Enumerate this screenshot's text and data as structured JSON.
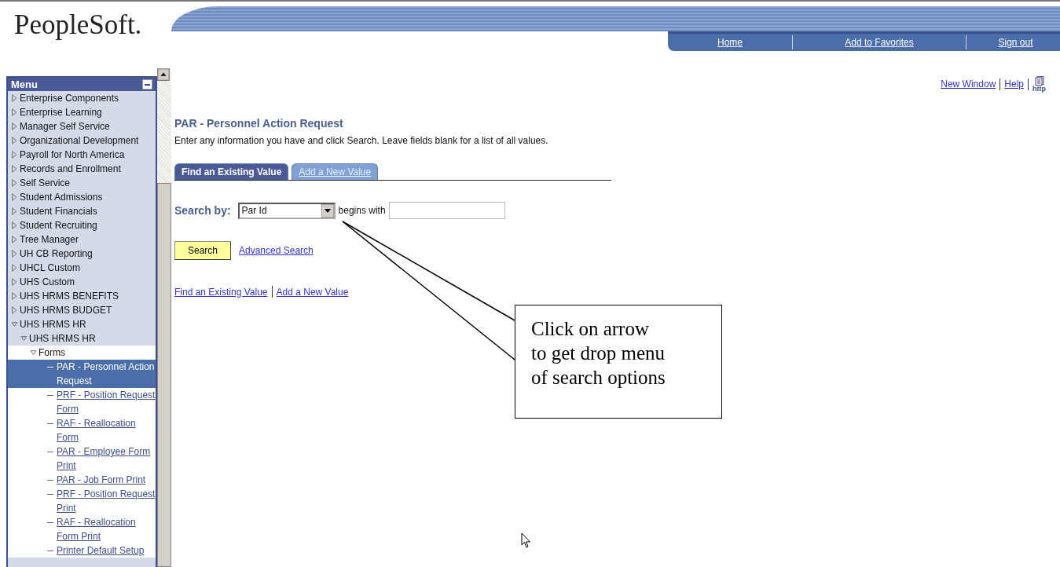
{
  "header": {
    "logo": "PeopleSoft.",
    "nav": [
      "Home",
      "Add to Favorites",
      "Sign out"
    ]
  },
  "sidebar": {
    "title": "Menu",
    "items": [
      {
        "label": "Enterprise Components",
        "kind": "folder",
        "expanded": false
      },
      {
        "label": "Enterprise Learning",
        "kind": "folder",
        "expanded": false
      },
      {
        "label": "Manager Self Service",
        "kind": "folder",
        "expanded": false
      },
      {
        "label": "Organizational Development",
        "kind": "folder",
        "expanded": false
      },
      {
        "label": "Payroll for North America",
        "kind": "folder",
        "expanded": false
      },
      {
        "label": "Records and Enrollment",
        "kind": "folder",
        "expanded": false
      },
      {
        "label": "Self Service",
        "kind": "folder",
        "expanded": false
      },
      {
        "label": "Student Admissions",
        "kind": "folder",
        "expanded": false
      },
      {
        "label": "Student Financials",
        "kind": "folder",
        "expanded": false
      },
      {
        "label": "Student Recruiting",
        "kind": "folder",
        "expanded": false
      },
      {
        "label": "Tree Manager",
        "kind": "folder",
        "expanded": false
      },
      {
        "label": "UH CB Reporting",
        "kind": "folder",
        "expanded": false
      },
      {
        "label": "UHCL Custom",
        "kind": "folder",
        "expanded": false
      },
      {
        "label": "UHS Custom",
        "kind": "folder",
        "expanded": false
      },
      {
        "label": "UHS HRMS BENEFITS",
        "kind": "folder",
        "expanded": false
      },
      {
        "label": "UHS HRMS BUDGET",
        "kind": "folder",
        "expanded": false
      },
      {
        "label": "UHS HRMS HR",
        "kind": "folder",
        "expanded": true,
        "children": [
          {
            "label": "UHS HRMS HR",
            "kind": "folder",
            "expanded": true,
            "children": [
              {
                "label": "Forms",
                "kind": "folder",
                "expanded": true,
                "children": [
                  {
                    "label": "PAR - Personnel Action Request",
                    "kind": "page",
                    "selected": true
                  },
                  {
                    "label": "PRF - Position Request Form",
                    "kind": "page",
                    "selected": false
                  },
                  {
                    "label": "RAF - Reallocation Form",
                    "kind": "page",
                    "selected": false
                  },
                  {
                    "label": "PAR - Employee Form Print",
                    "kind": "page",
                    "selected": false
                  },
                  {
                    "label": "PAR - Job Form Print",
                    "kind": "page",
                    "selected": false
                  },
                  {
                    "label": "PRF - Position Request Print",
                    "kind": "page",
                    "selected": false
                  },
                  {
                    "label": "RAF - Reallocation Form Print",
                    "kind": "page",
                    "selected": false
                  },
                  {
                    "label": "Printer Default Setup",
                    "kind": "page",
                    "selected": false
                  }
                ]
              }
            ]
          }
        ]
      }
    ]
  },
  "toplinks": {
    "links": [
      "New Window",
      "Help"
    ],
    "icon_label": "http"
  },
  "page": {
    "title": "PAR - Personnel Action Request",
    "description": "Enter any information you have and click Search. Leave fields blank for a list of all values.",
    "tabs": [
      {
        "label": "Find an Existing Value",
        "selected": true
      },
      {
        "label": "Add a New Value",
        "selected": false
      }
    ],
    "search_by_label": "Search by:",
    "search_by_value": "Par Id",
    "operator": "begins with",
    "search_button": "Search",
    "advanced_link": "Advanced Search",
    "bottom_links": [
      "Find an Existing Value",
      "Add a New Value"
    ]
  },
  "callout": {
    "lines": [
      "Click on arrow",
      "to get drop menu",
      "of search options"
    ]
  }
}
